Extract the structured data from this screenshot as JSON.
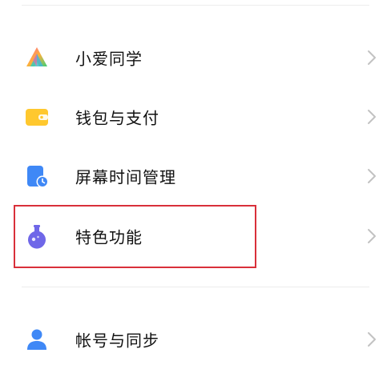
{
  "settings_list": {
    "items": [
      {
        "id": "xiaoai",
        "label": "小爱同学",
        "icon": "xiaoai-assistant-icon"
      },
      {
        "id": "wallet",
        "label": "钱包与支付",
        "icon": "wallet-icon"
      },
      {
        "id": "screen_time",
        "label": "屏幕时间管理",
        "icon": "screen-time-icon"
      },
      {
        "id": "special_features",
        "label": "特色功能",
        "icon": "flask-icon"
      },
      {
        "id": "account_sync",
        "label": "帐号与同步",
        "icon": "person-icon"
      }
    ],
    "chevron_icon": "chevron-right-icon"
  },
  "highlight": {
    "target": "special_features",
    "border_color": "#d9303a"
  },
  "colors": {
    "xiaoai_gradient": [
      "#ff5fa2",
      "#ffc23a",
      "#3ad07a",
      "#4d9bff"
    ],
    "wallet": "#ffc82e",
    "screen_time": "#3f88f6",
    "special_features": "#6f67e8",
    "account": "#3f88f6",
    "chevron": "#c2c2c2"
  }
}
